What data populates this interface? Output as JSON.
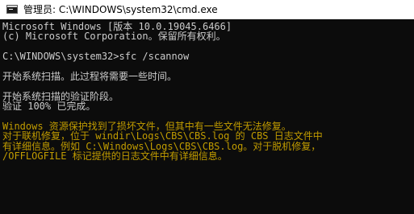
{
  "window": {
    "title": "管理员: C:\\WINDOWS\\system32\\cmd.exe",
    "icon": "cmd-icon"
  },
  "colors": {
    "background": "#0c0c0c",
    "default_text": "#cccccc",
    "warning_text": "#c19c00"
  },
  "console": {
    "lines": [
      "Microsoft Windows [版本 10.0.19045.6466]",
      "(c) Microsoft Corporation。保留所有权利。",
      "",
      "C:\\WINDOWS\\system32>sfc /scannow",
      "",
      "开始系统扫描。此过程将需要一些时间。",
      "",
      "开始系统扫描的验证阶段。",
      "验证 100% 已完成。",
      "",
      "Windows 资源保护找到了损坏文件，但其中有一些文件无法修复。",
      "对于联机修复，位于 windir\\Logs\\CBS\\CBS.log 的 CBS 日志文件中",
      "有详细信息。例如 C:\\Windows\\Logs\\CBS\\CBS.log。对于脱机修复，",
      "/OFFLOGFILE 标记提供的日志文件中有详细信息。"
    ]
  }
}
